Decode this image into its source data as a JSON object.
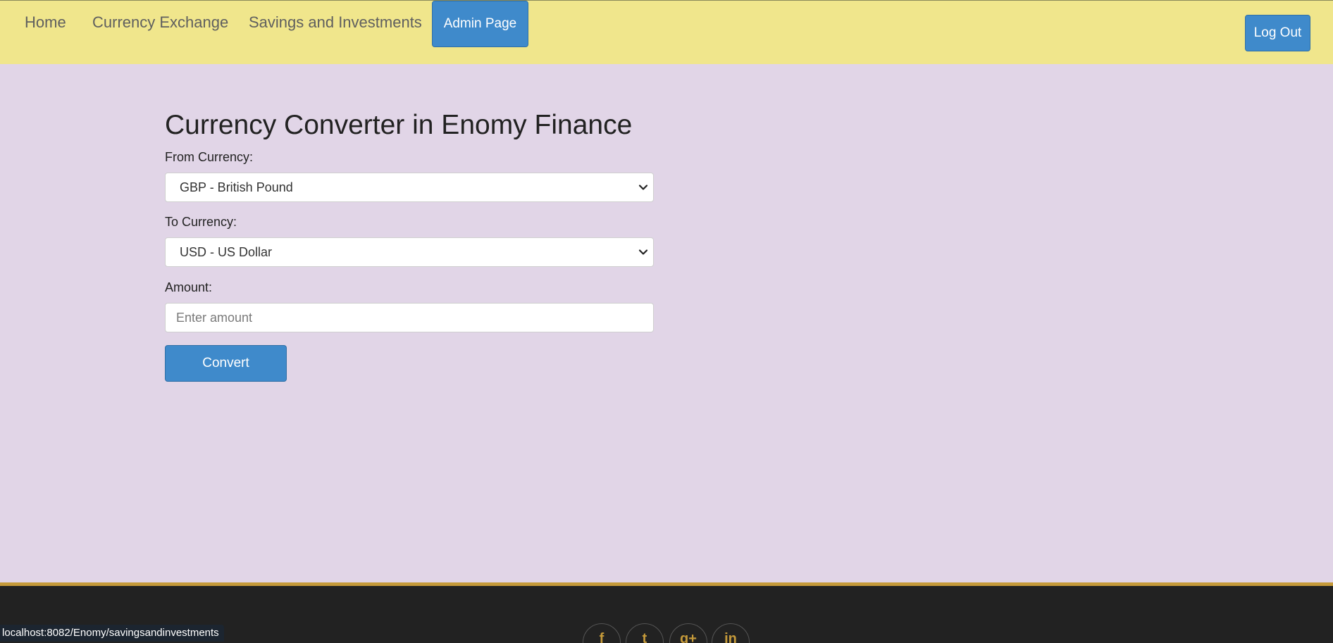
{
  "nav": {
    "links": [
      "Home",
      "Currency Exchange",
      "Savings and Investments"
    ],
    "active": "Admin Page",
    "logout": "Log Out"
  },
  "form": {
    "title": "Currency Converter in Enomy Finance",
    "from_label": "From Currency:",
    "from_value": "GBP - British Pound",
    "to_label": "To Currency:",
    "to_value": "USD - US Dollar",
    "amount_label": "Amount:",
    "amount_placeholder": "Enter amount",
    "convert": "Convert"
  },
  "footer": {
    "social_icons": [
      "facebook-icon",
      "twitter-icon",
      "google-plus-icon",
      "linkedin-icon"
    ],
    "social_glyphs": [
      "f",
      "t",
      "g+",
      "in"
    ]
  },
  "status_bar": {
    "url": "localhost:8082/Enomy/savingsandinvestments"
  },
  "colors": {
    "navbar": "#f0e68c",
    "main_bg": "#e1d5e7",
    "accent": "#3f8acb",
    "footer": "#222222",
    "footer_border": "#c59a3a"
  }
}
